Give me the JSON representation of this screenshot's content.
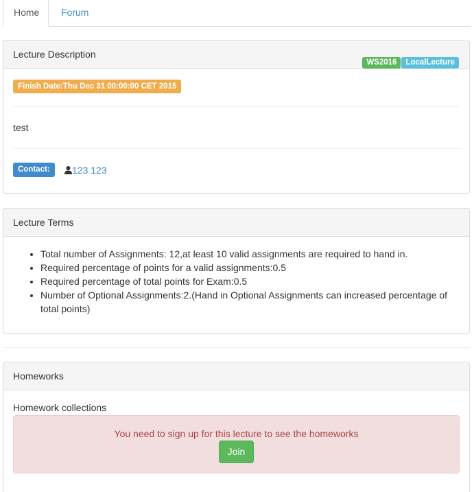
{
  "tabs": [
    {
      "label": "Home"
    },
    {
      "label": "Forum"
    }
  ],
  "description": {
    "heading": "Lecture Description",
    "badges": [
      "WS2016",
      "LocalLecture"
    ],
    "finish_date": "Finish Date:Thu Dec 31 00:00:00 CET 2015",
    "text": "test",
    "contact_label": "Contact:",
    "contact_name": "123 123"
  },
  "terms": {
    "heading": "Lecture Terms",
    "items": [
      "Total number of Assignments: 12,at least 10 valid assignments are required to hand in.",
      "Required percentage of points for a valid assignments:0.5",
      "Required percentage of total points for Exam:0.5",
      "Number of Optional Assignments:2.(Hand in Optional Assignments can increased percentage of total points)"
    ]
  },
  "homeworks": {
    "heading": "Homeworks",
    "subheading": "Homework collections",
    "alert": "You need to sign up for this lecture to see the homeworks",
    "join_label": "Join"
  },
  "colors": {
    "link": "#428bca",
    "success": "#5cb85c",
    "info": "#5bc0de",
    "warning": "#f0ad4e",
    "alert_bg": "#f2dede",
    "alert_text": "#a94442"
  }
}
